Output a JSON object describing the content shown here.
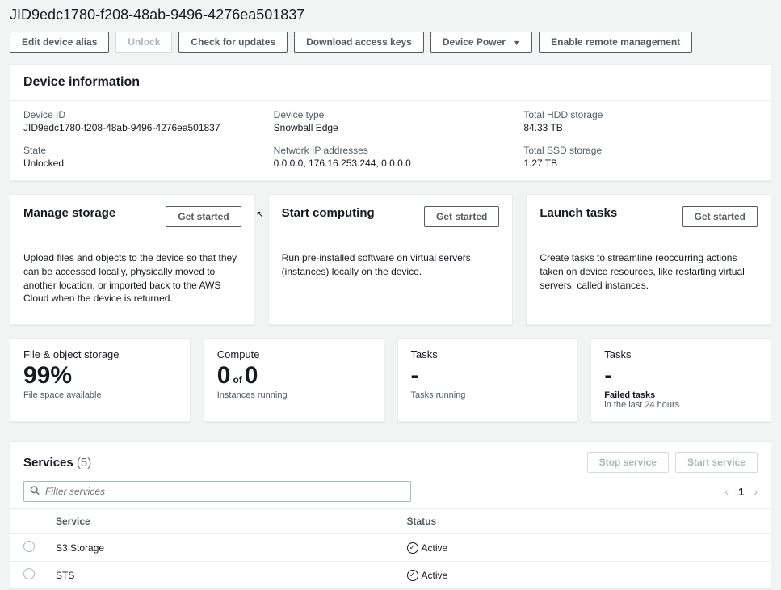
{
  "page": {
    "title": "JID9edc1780-f208-48ab-9496-4276ea501837"
  },
  "toolbar": {
    "edit_alias": "Edit device alias",
    "unlock": "Unlock",
    "check_updates": "Check for updates",
    "download_keys": "Download access keys",
    "device_power": "Device Power",
    "enable_remote": "Enable remote management"
  },
  "device_info": {
    "header": "Device information",
    "device_id_label": "Device ID",
    "device_id": "JID9edc1780-f208-48ab-9496-4276ea501837",
    "device_type_label": "Device type",
    "device_type": "Snowball Edge",
    "hdd_label": "Total HDD storage",
    "hdd": "84.33 TB",
    "state_label": "State",
    "state": "Unlocked",
    "ip_label": "Network IP addresses",
    "ip": "0.0.0.0, 176.16.253.244, 0.0.0.0",
    "ssd_label": "Total SSD storage",
    "ssd": "1.27 TB"
  },
  "cards": {
    "storage": {
      "title": "Manage storage",
      "button": "Get started",
      "desc": "Upload files and objects to the device so that they can be accessed locally, physically moved to another location, or imported back to the AWS Cloud when the device is returned."
    },
    "compute": {
      "title": "Start computing",
      "button": "Get started",
      "desc": "Run pre-installed software on virtual servers (instances) locally on the device."
    },
    "tasks": {
      "title": "Launch tasks",
      "button": "Get started",
      "desc": "Create tasks to streamline reoccurring actions taken on device resources, like restarting virtual servers, called instances."
    }
  },
  "metrics": {
    "storage": {
      "title": "File & object storage",
      "value": "99%",
      "sub": "File space available"
    },
    "compute": {
      "title": "Compute",
      "v1": "0",
      "of": "of",
      "v2": "0",
      "sub": "Instances running"
    },
    "tasks_running": {
      "title": "Tasks",
      "value": "-",
      "sub": "Tasks running"
    },
    "tasks_failed": {
      "title": "Tasks",
      "value": "-",
      "sub1": "Failed tasks",
      "sub2": "in the last 24 hours"
    }
  },
  "services": {
    "title": "Services",
    "count": "(5)",
    "stop": "Stop service",
    "start": "Start service",
    "filter_placeholder": "Filter services",
    "page": "1",
    "col_service": "Service",
    "col_status": "Status",
    "rows": [
      {
        "name": "S3 Storage",
        "status": "Active"
      },
      {
        "name": "STS",
        "status": "Active"
      }
    ]
  }
}
